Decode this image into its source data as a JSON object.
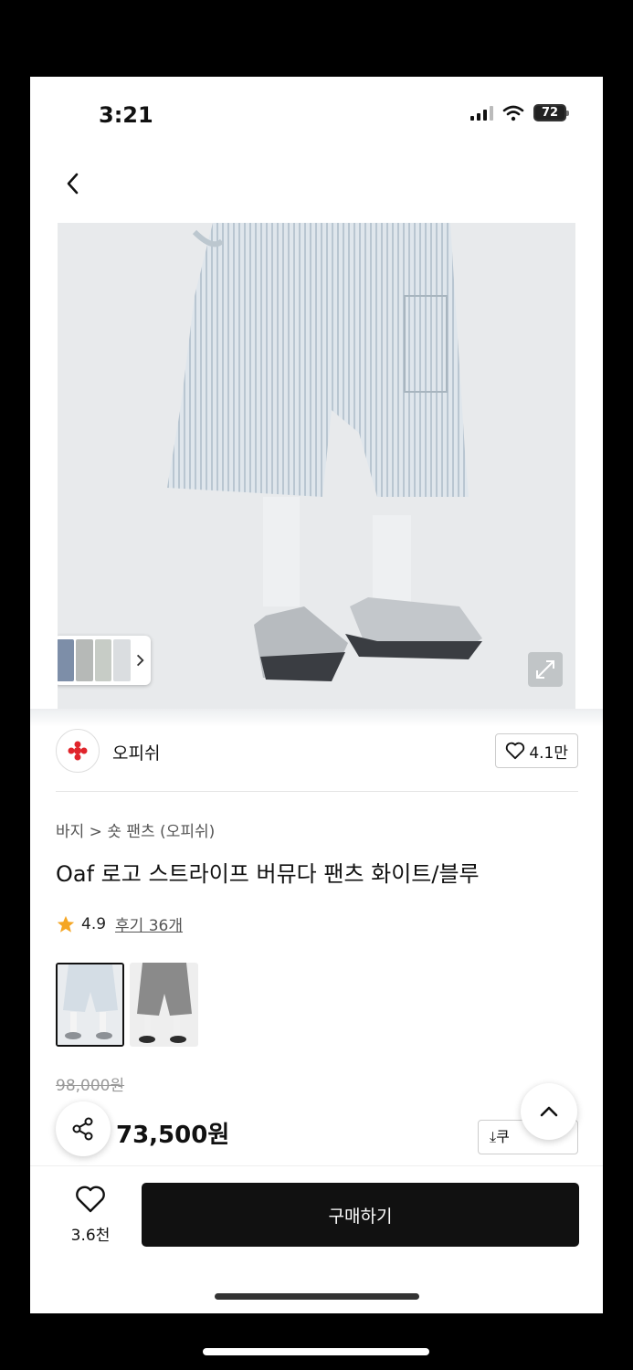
{
  "status_bar": {
    "time": "3:21",
    "battery": "72"
  },
  "nav": {
    "back_icon": "chevron-left-icon",
    "home_icon": "home-icon",
    "search_icon": "search-icon",
    "bag_icon": "shopping-bag-icon"
  },
  "brand": {
    "name": "오피쉬",
    "likes": "4.1만"
  },
  "product": {
    "breadcrumb": "바지 > 숏 팬츠 (오피쉬)",
    "title": "Oaf 로고 스트라이프 버뮤다 팬츠 화이트/블루",
    "rating": "4.9",
    "reviews": "후기 36개",
    "original_price": "98,000원",
    "price": "73,500원",
    "coupon_label": "⤓쿠"
  },
  "bottom": {
    "wish_count": "3.6천",
    "buy_label": "구매하기"
  },
  "colors": {
    "accent": "#111111",
    "star": "#f5a623",
    "brand_logo": "#e0242b"
  }
}
